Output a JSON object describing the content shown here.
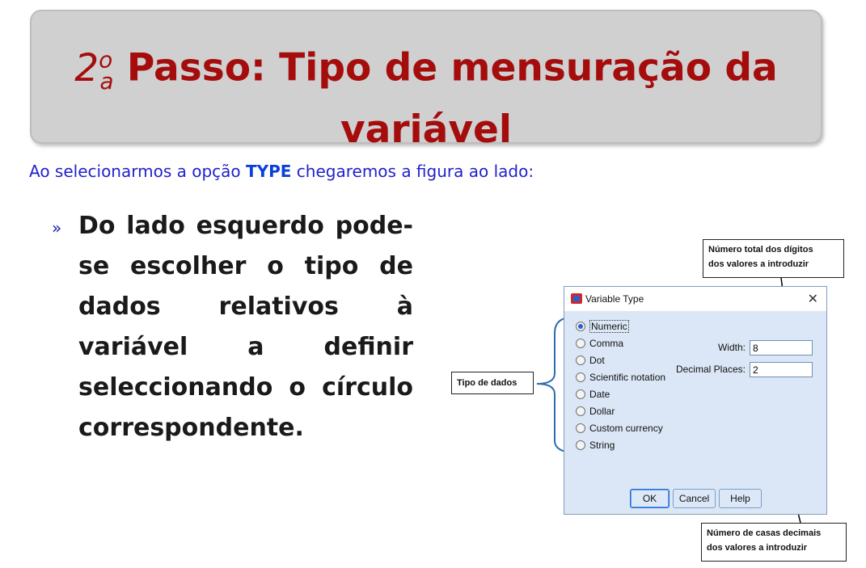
{
  "slide": {
    "title_ordinal_main": "2",
    "title_ordinal_sup": "o",
    "title_ordinal_sub": "a",
    "title_line1": "Passo: Tipo de mensuração da",
    "title_line2": "variável",
    "subtitle_before": "Ao selecionarmos a opção ",
    "subtitle_keyword": "TYPE",
    "subtitle_after": " chegaremos a figura ao lado:",
    "bullet_marker": "»",
    "bullet_text": "Do lado esquerdo pode-se escolher o tipo de dados relativos à variável a definir seleccionando o círculo correspondente."
  },
  "dialog": {
    "title": "Variable Type",
    "close_glyph": "✕",
    "options": [
      {
        "label": "Numeric",
        "selected": true
      },
      {
        "label": "Comma",
        "selected": false
      },
      {
        "label": "Dot",
        "selected": false
      },
      {
        "label": "Scientific notation",
        "selected": false
      },
      {
        "label": "Date",
        "selected": false
      },
      {
        "label": "Dollar",
        "selected": false
      },
      {
        "label": "Custom currency",
        "selected": false
      },
      {
        "label": "String",
        "selected": false
      }
    ],
    "width_label": "Width:",
    "width_value": "8",
    "decimal_label": "Decimal Places:",
    "decimal_value": "2",
    "ok_label": "OK",
    "cancel_label": "Cancel",
    "help_label": "Help"
  },
  "callouts": {
    "data_type": "Tipo de dados",
    "width_line1": "Número total dos dígitos",
    "width_line2": "dos valores a introduzir",
    "decimals_line1": "Número de casas decimais",
    "decimals_line2": "dos valores a introduzir"
  },
  "colors": {
    "title_red": "#a50d0d",
    "subtitle_blue": "#2222cc",
    "dialog_bg": "#dbe7f6"
  }
}
